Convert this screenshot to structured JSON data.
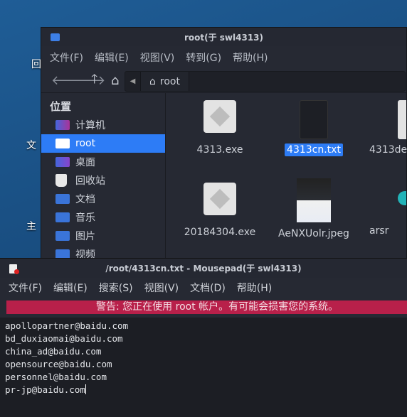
{
  "desktop": {
    "icons": [
      {
        "label": "回"
      },
      {
        "label": "文"
      },
      {
        "label": "主"
      }
    ]
  },
  "file_manager": {
    "title": "root(于 swl4313)",
    "menu": [
      "文件(F)",
      "编辑(E)",
      "视图(V)",
      "转到(G)",
      "帮助(H)"
    ],
    "path": "root",
    "sidebar": {
      "heading": "位置",
      "items": [
        {
          "label": "计算机"
        },
        {
          "label": "root",
          "selected": true
        },
        {
          "label": "桌面"
        },
        {
          "label": "回收站"
        },
        {
          "label": "文档"
        },
        {
          "label": "音乐"
        },
        {
          "label": "图片"
        },
        {
          "label": "视频"
        }
      ]
    },
    "files": [
      {
        "name": "4313.exe"
      },
      {
        "name": "4313cn.txt",
        "selected": true
      },
      {
        "name": "4313de"
      },
      {
        "name": "20184304.exe"
      },
      {
        "name": "AeNXUolr.jpeg"
      },
      {
        "name": "arsr"
      }
    ]
  },
  "mousepad": {
    "title": "/root/4313cn.txt - Mousepad(于 swl4313)",
    "menu": [
      "文件(F)",
      "编辑(E)",
      "搜索(S)",
      "视图(V)",
      "文档(D)",
      "帮助(H)"
    ],
    "warning": "警告: 您正在使用 root 帐户。有可能会损害您的系统。",
    "lines": [
      "apollopartner@baidu.com",
      "bd_duxiaomai@baidu.com",
      "china_ad@baidu.com",
      "opensource@baidu.com",
      "personnel@baidu.com",
      "pr-jp@baidu.com"
    ]
  },
  "colors": {
    "accent": "#2d7cf6",
    "warning": "#b8204a"
  }
}
